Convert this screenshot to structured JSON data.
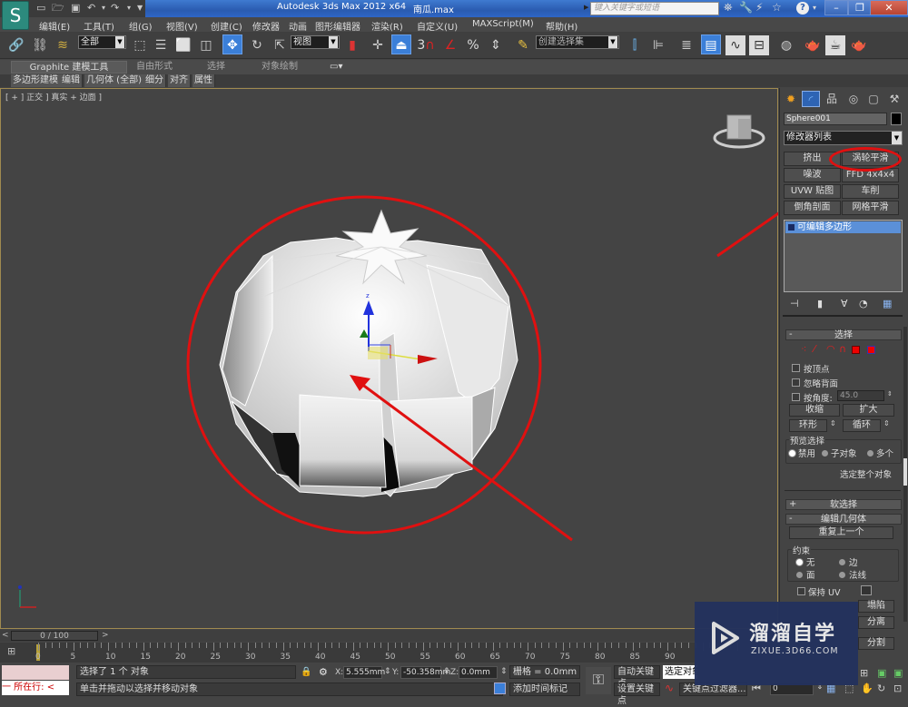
{
  "window": {
    "app_title": "Autodesk 3ds Max  2012 x64",
    "file_name": "南瓜.max",
    "search_placeholder": "键入关键字或短语",
    "logo_glyph": "S"
  },
  "quick_access": [
    "new-file",
    "open-file",
    "save-file",
    "undo",
    "redo",
    "customize"
  ],
  "menu": [
    "编辑(E)",
    "工具(T)",
    "组(G)",
    "视图(V)",
    "创建(C)",
    "修改器",
    "动画",
    "图形编辑器",
    "渲染(R)",
    "自定义(U)",
    "MAXScript(M)",
    "帮助(H)"
  ],
  "toolbar": {
    "selection_filter": "全部",
    "ref_coord": "视图",
    "named_selection": "创建选择集",
    "snap_label": "3"
  },
  "ribbon": {
    "tabs": [
      "Graphite 建模工具",
      "自由形式",
      "选择",
      "对象绘制"
    ],
    "subtabs": [
      "多边形建模",
      "编辑",
      "几何体 (全部)",
      "细分",
      "对齐",
      "属性"
    ]
  },
  "viewport": {
    "label": "[ + ] 正交 ] 真实 + 边面 ]",
    "object": "Sphere001 (pumpkin mesh)",
    "annotation_color": "#e01010"
  },
  "command_panel": {
    "object_name": "Sphere001",
    "modifier_list": "修改器列表",
    "modifier_buttons": [
      "挤出",
      "涡轮平滑",
      "噪波",
      "FFD 4x4x4",
      "UVW 贴图",
      "车削",
      "倒角剖面",
      "网格平滑"
    ],
    "highlighted_modifier": "涡轮平滑",
    "stack": [
      "可编辑多边形"
    ],
    "selection_rollout": {
      "title": "选择",
      "by_vertex": "按顶点",
      "ignore_backfacing": "忽略背面",
      "by_angle": "按角度:",
      "angle_value": "45.0",
      "shrink": "收缩",
      "grow": "扩大",
      "ring": "环形",
      "loop": "循环",
      "preview_group": "预览选择",
      "preview_options": [
        "禁用",
        "子对象",
        "多个"
      ],
      "preview_selected": "禁用",
      "status": "选定整个对象"
    },
    "soft_selection": "软选择",
    "edit_geometry": {
      "title": "编辑几何体",
      "repeat_last": "重复上一个",
      "constraints_group": "约束",
      "constraints": [
        "无",
        "边",
        "面",
        "法线"
      ],
      "constraint_selected": "无",
      "preserve_uv": "保持 UV",
      "collapse": "塌陷",
      "detach": "分离",
      "slice": "分割"
    }
  },
  "timeline": {
    "position": "0 / 100",
    "current_frame": 0,
    "ticks": [
      0,
      5,
      10,
      15,
      20,
      25,
      30,
      35,
      40,
      45,
      50,
      55,
      60,
      65,
      70,
      75,
      80,
      85,
      90
    ]
  },
  "status": {
    "listener_text": "一  所在行:  <",
    "selected": "选择了 1 个 对象",
    "prompt": "单击并拖动以选择并移动对象",
    "x_label": "X:",
    "x": "5.555mm",
    "y_label": "Y:",
    "y": "-50.358mm",
    "z_label": "Z:",
    "z": "0.0mm",
    "grid": "栅格 = 0.0mm",
    "add_time_tag": "添加时间标记",
    "auto_key": "自动关键点",
    "set_key": "设置关键点",
    "key_mode": "选定对象",
    "key_filters": "关键点过滤器...",
    "frame_field": "0"
  },
  "watermark": {
    "title": "溜溜自学",
    "url": "ZIXUE.3D66.COM"
  }
}
